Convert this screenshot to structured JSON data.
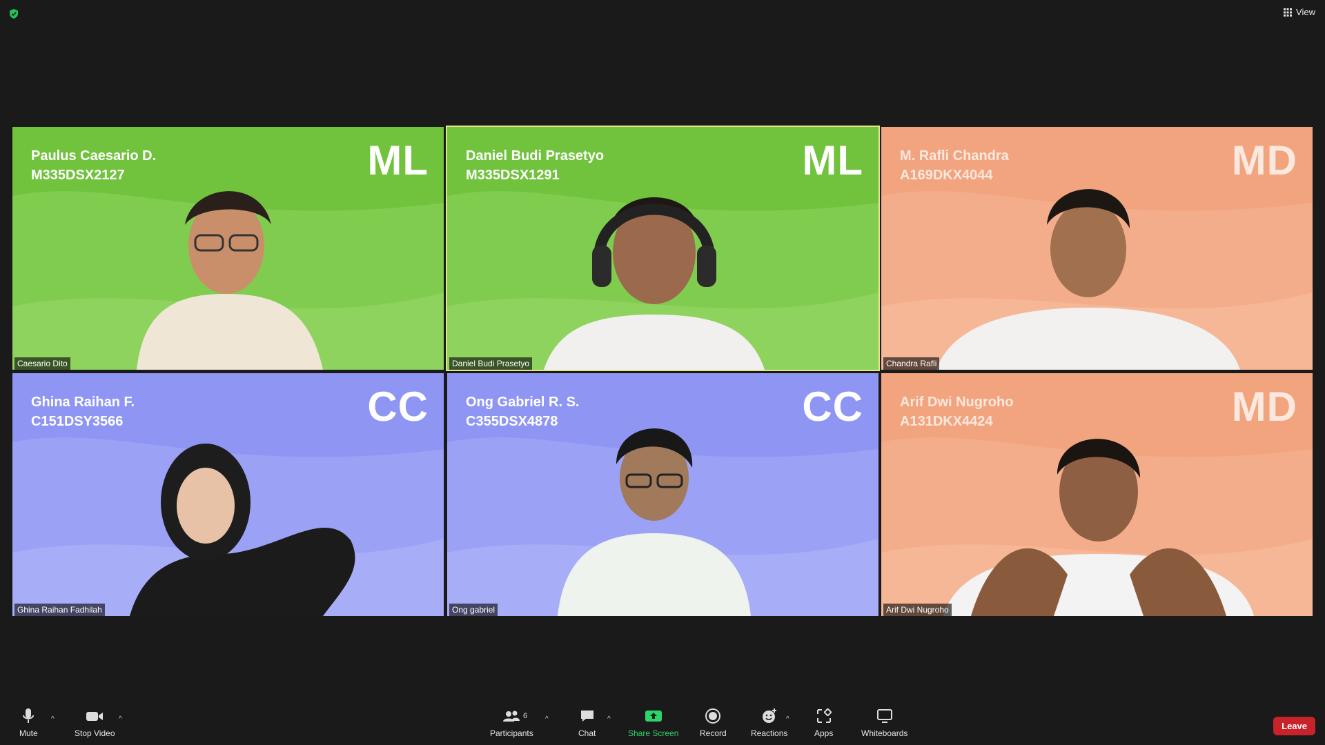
{
  "topbar": {
    "view_label": "View"
  },
  "tiles": [
    {
      "name_line": "Paulus Caesario D.",
      "id_line": "M335DSX2127",
      "tag": "ML",
      "nametag": "Caesario Dito",
      "theme": "green"
    },
    {
      "name_line": "Daniel Budi Prasetyo",
      "id_line": "M335DSX1291",
      "tag": "ML",
      "nametag": "Daniel Budi Prasetyo",
      "theme": "green",
      "active": true
    },
    {
      "name_line": "M. Rafli Chandra",
      "id_line": "A169DKX4044",
      "tag": "MD",
      "nametag": "Chandra Rafli",
      "theme": "orange"
    },
    {
      "name_line": "Ghina Raihan F.",
      "id_line": "C151DSY3566",
      "tag": "CC",
      "nametag": "Ghina Raihan Fadhilah",
      "theme": "purple"
    },
    {
      "name_line": "Ong Gabriel R. S.",
      "id_line": "C355DSX4878",
      "tag": "CC",
      "nametag": "Ong gabriel",
      "theme": "purple"
    },
    {
      "name_line": "Arif Dwi Nugroho",
      "id_line": "A131DKX4424",
      "tag": "MD",
      "nametag": "Arif Dwi Nugroho",
      "theme": "orange"
    }
  ],
  "toolbar": {
    "mute": "Mute",
    "stop_video": "Stop Video",
    "participants": "Participants",
    "participants_count": "6",
    "chat": "Chat",
    "share_screen": "Share Screen",
    "record": "Record",
    "reactions": "Reactions",
    "apps": "Apps",
    "whiteboards": "Whiteboards",
    "leave": "Leave"
  },
  "colors": {
    "green_bg": "#71c23c",
    "purple_bg": "#8f95f3",
    "orange_bg": "#f2a47e",
    "active_border": "#e7e58a",
    "leave": "#c8222a"
  }
}
